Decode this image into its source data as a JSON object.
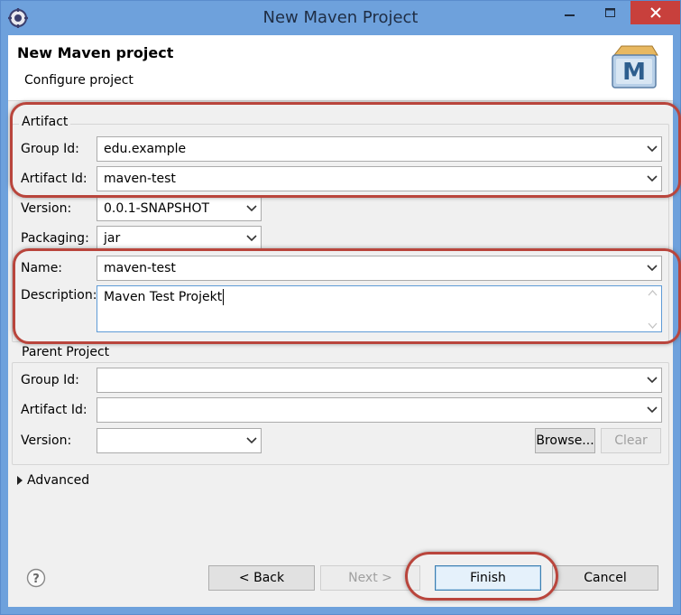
{
  "window": {
    "title": "New Maven Project"
  },
  "header": {
    "title": "New Maven project",
    "subtitle": "Configure project",
    "logo_letter": "M"
  },
  "artifact": {
    "group_label": "Artifact",
    "group_id_label": "Group Id:",
    "group_id_value": "edu.example",
    "artifact_id_label": "Artifact Id:",
    "artifact_id_value": "maven-test",
    "version_label": "Version:",
    "version_value": "0.0.1-SNAPSHOT",
    "packaging_label": "Packaging:",
    "packaging_value": "jar",
    "name_label": "Name:",
    "name_value": "maven-test",
    "description_label": "Description:",
    "description_value": "Maven Test Projekt"
  },
  "parent": {
    "group_label": "Parent Project",
    "group_id_label": "Group Id:",
    "group_id_value": "",
    "artifact_id_label": "Artifact Id:",
    "artifact_id_value": "",
    "version_label": "Version:",
    "version_value": "",
    "browse_label": "Browse...",
    "clear_label": "Clear"
  },
  "advanced": {
    "label": "Advanced"
  },
  "footer": {
    "back_label": "< Back",
    "next_label": "Next >",
    "finish_label": "Finish",
    "cancel_label": "Cancel"
  },
  "colors": {
    "titlebar": "#6ea1dc",
    "close_button": "#c8403c",
    "highlight": "#b9453c"
  }
}
